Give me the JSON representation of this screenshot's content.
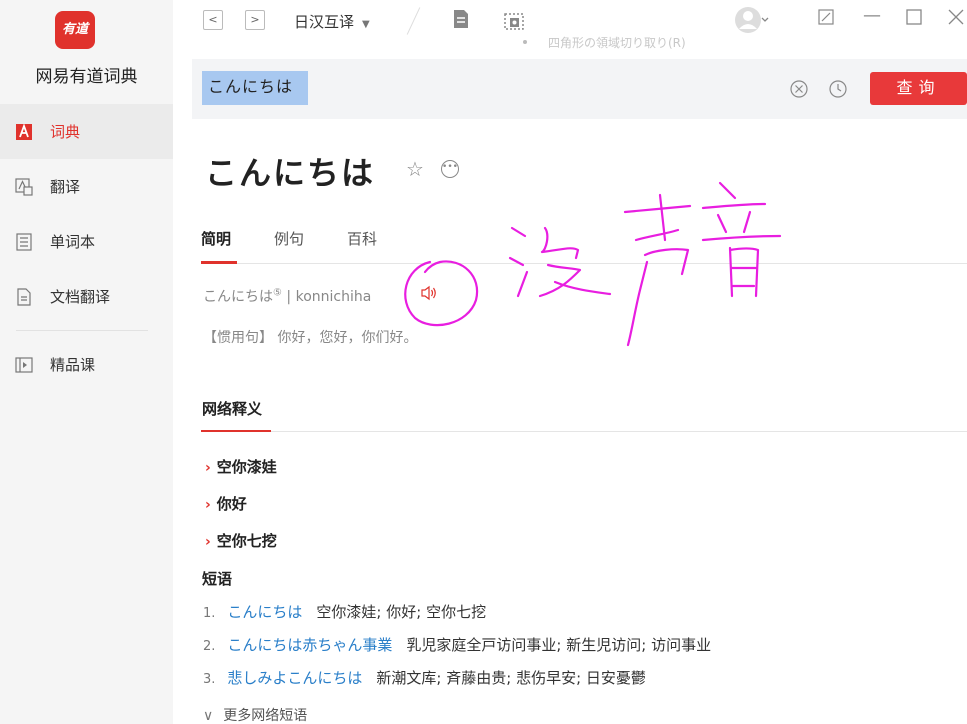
{
  "sidebar": {
    "logo_text": "有道",
    "app_name": "网易有道词典",
    "items": [
      {
        "label": "词典",
        "icon": "dictionary-icon",
        "active": true
      },
      {
        "label": "翻译",
        "icon": "translate-icon",
        "active": false
      },
      {
        "label": "单词本",
        "icon": "wordbook-icon",
        "active": false
      },
      {
        "label": "文档翻译",
        "icon": "document-translate-icon",
        "active": false
      }
    ],
    "extra_item": {
      "label": "精品课",
      "icon": "course-icon"
    }
  },
  "topbar": {
    "mode": "日汉互译",
    "ghost_text": "四角形の領域切り取り(R)"
  },
  "search": {
    "value": "こんにちは",
    "button_label": "查询"
  },
  "entry": {
    "headword": "こんにちは",
    "tabs": [
      "简明",
      "例句",
      "百科"
    ],
    "pronunciation_word": "こんにちは",
    "pronunciation_tone": "⑤",
    "pronunciation_romaji": " | konnichiha",
    "idiom": "【惯用句】 你好，您好，你们好。"
  },
  "network": {
    "title": "网络释义",
    "items": [
      "空你漆娃",
      "你好",
      "空你七挖"
    ]
  },
  "phrases": {
    "title": "短语",
    "items": [
      {
        "num": "1.",
        "jp": "こんにちは",
        "cn": "空你漆娃;  你好;  空你七挖"
      },
      {
        "num": "2.",
        "jp": "こんにちは赤ちゃん事業",
        "cn": "乳児家庭全戸访问事业;  新生児访问;  访问事业"
      },
      {
        "num": "3.",
        "jp": "悲しみよこんにちは",
        "cn": "新潮文库;  斉藤由贵;  悲伤早安;  日安憂鬱"
      }
    ],
    "more_label": "更多网络短语"
  },
  "colors": {
    "accent": "#e0322c",
    "link": "#2a7fc9",
    "annotation": "#e81ee0"
  }
}
